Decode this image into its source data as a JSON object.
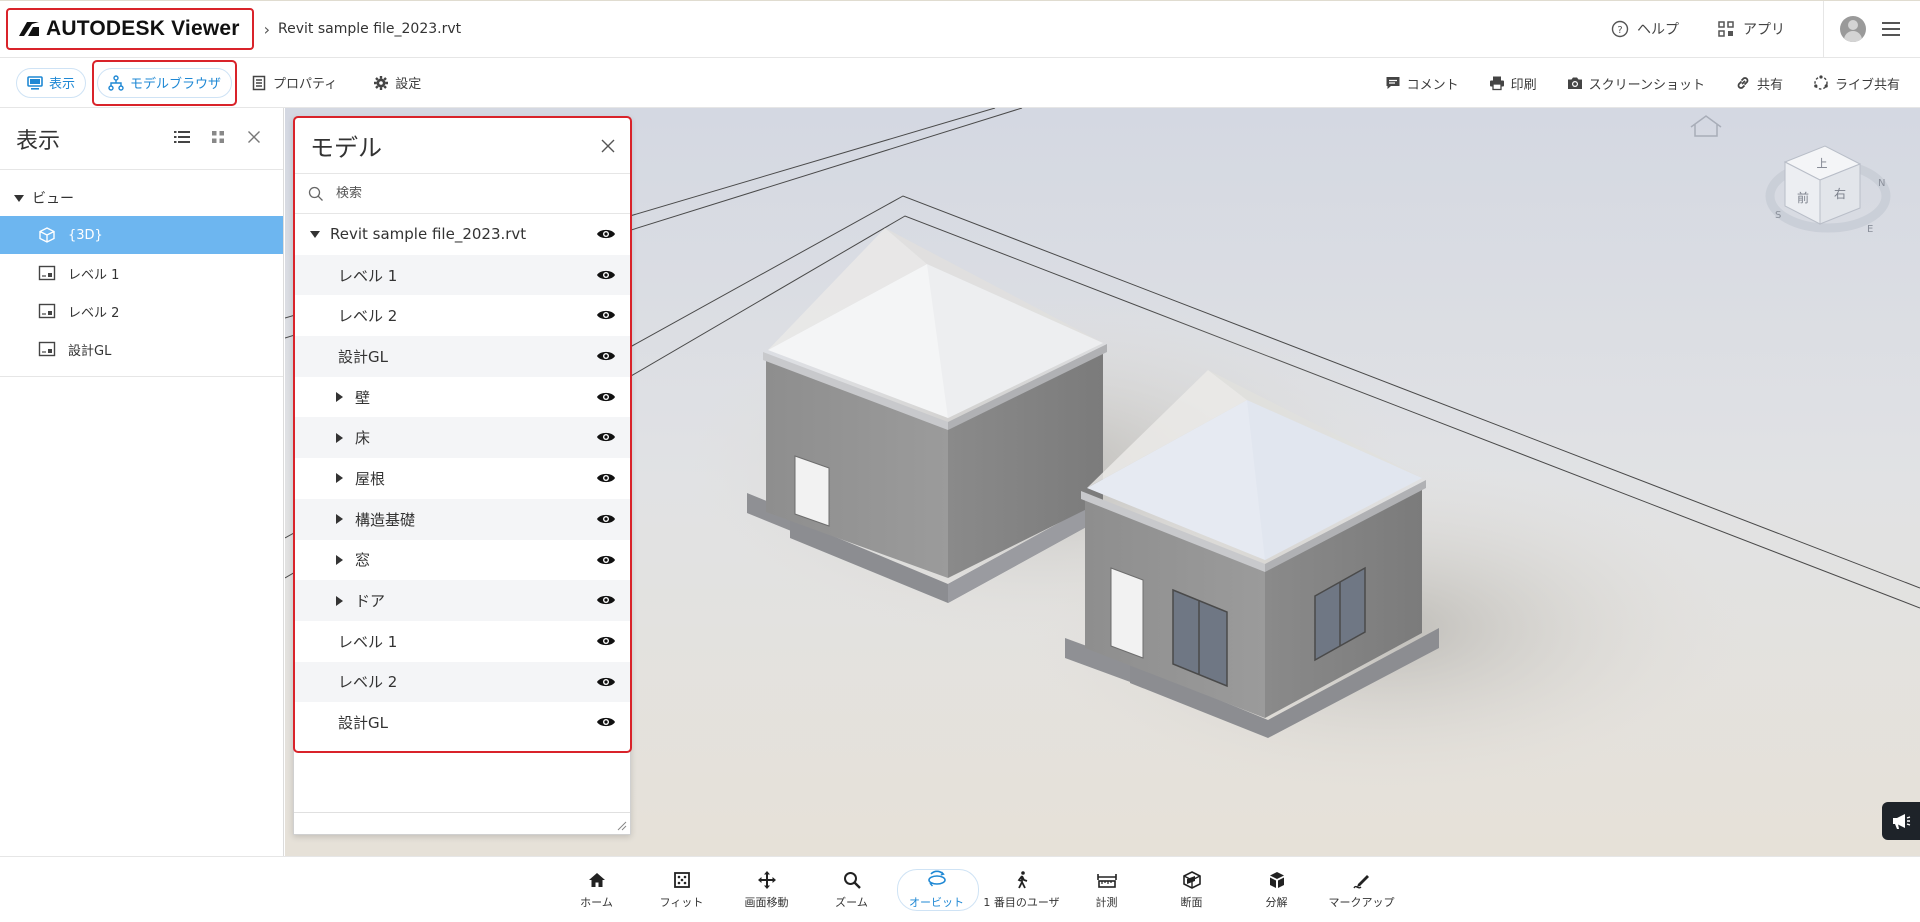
{
  "header": {
    "logo_text": "AUTODESK Viewer",
    "breadcrumb_file": "Revit sample file_2023.rvt",
    "help_label": "ヘルプ",
    "apps_label": "アプリ"
  },
  "toolbar": {
    "view_label": "表示",
    "model_browser_label": "モデルブラウザ",
    "properties_label": "プロパティ",
    "settings_label": "設定",
    "comments_label": "コメント",
    "print_label": "印刷",
    "screenshot_label": "スクリーンショット",
    "share_label": "共有",
    "live_share_label": "ライブ共有"
  },
  "left_panel": {
    "title": "表示",
    "section_label": "ビュー",
    "views": [
      {
        "label": "{3D}",
        "icon": "cube-icon",
        "selected": true
      },
      {
        "label": "レベル 1",
        "icon": "floorplan-icon",
        "selected": false
      },
      {
        "label": "レベル 2",
        "icon": "floorplan-icon",
        "selected": false
      },
      {
        "label": "設計GL",
        "icon": "floorplan-icon",
        "selected": false
      }
    ]
  },
  "model_panel": {
    "title": "モデル",
    "search_placeholder": "検索",
    "root_label": "Revit sample file_2023.rvt",
    "rows": [
      {
        "label": "レベル 1",
        "expandable": false
      },
      {
        "label": "レベル 2",
        "expandable": false
      },
      {
        "label": "設計GL",
        "expandable": false
      },
      {
        "label": "壁",
        "expandable": true
      },
      {
        "label": "床",
        "expandable": true
      },
      {
        "label": "屋根",
        "expandable": true
      },
      {
        "label": "構造基礎",
        "expandable": true
      },
      {
        "label": "窓",
        "expandable": true
      },
      {
        "label": "ドア",
        "expandable": true
      },
      {
        "label": "レベル 1",
        "expandable": false
      },
      {
        "label": "レベル 2",
        "expandable": false
      },
      {
        "label": "設計GL",
        "expandable": false
      }
    ]
  },
  "viewcube": {
    "front_label": "前",
    "right_label": "右",
    "top_label": "上",
    "compass_s": "S",
    "compass_e": "E",
    "compass_n": "N"
  },
  "bottom_toolbar": {
    "items": [
      {
        "label": "ホーム",
        "icon": "home-icon",
        "active": false
      },
      {
        "label": "フィット",
        "icon": "fit-icon",
        "active": false
      },
      {
        "label": "画面移動",
        "icon": "pan-icon",
        "active": false
      },
      {
        "label": "ズーム",
        "icon": "zoom-icon",
        "active": false
      },
      {
        "label": "オービット",
        "icon": "orbit-icon",
        "active": true
      },
      {
        "label": "1 番目のユーザ",
        "icon": "walk-icon",
        "active": false
      },
      {
        "label": "計測",
        "icon": "measure-icon",
        "active": false
      },
      {
        "label": "断面",
        "icon": "section-icon",
        "active": false
      },
      {
        "label": "分解",
        "icon": "explode-icon",
        "active": false
      },
      {
        "label": "マークアップ",
        "icon": "markup-icon",
        "active": false
      }
    ]
  },
  "colors": {
    "accent_blue": "#1f88d4",
    "selection_blue": "#6db6f0",
    "highlight_red": "#d9232a"
  }
}
